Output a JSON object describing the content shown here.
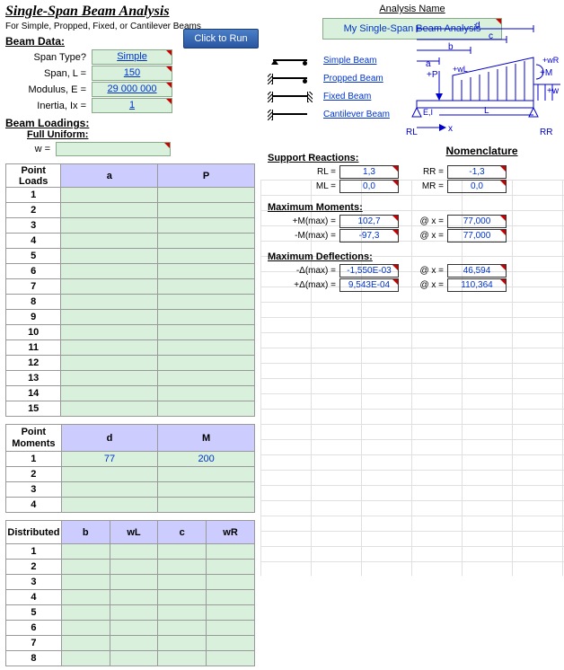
{
  "title": "Single-Span Beam Analysis",
  "subtitle": "For Simple, Propped, Fixed, or Cantilever Beams",
  "run_btn": "Click to Run",
  "beam_data": {
    "heading": "Beam Data:",
    "span_type_lbl": "Span Type?",
    "span_type": "Simple",
    "span_lbl": "Span, L =",
    "span": "150",
    "modulus_lbl": "Modulus, E =",
    "modulus": "29 000 000",
    "inertia_lbl": "Inertia, Ix =",
    "inertia": "1"
  },
  "beam_loadings": {
    "heading": "Beam Loadings:",
    "full_uniform_lbl": "Full Uniform:",
    "w_lbl": "w =",
    "w": ""
  },
  "point_loads": {
    "heading": "Point Loads",
    "cols": [
      "a",
      "P"
    ],
    "rows": [
      {
        "n": "1",
        "a": "",
        "p": ""
      },
      {
        "n": "2",
        "a": "",
        "p": ""
      },
      {
        "n": "3",
        "a": "",
        "p": ""
      },
      {
        "n": "4",
        "a": "",
        "p": ""
      },
      {
        "n": "5",
        "a": "",
        "p": ""
      },
      {
        "n": "6",
        "a": "",
        "p": ""
      },
      {
        "n": "7",
        "a": "",
        "p": ""
      },
      {
        "n": "8",
        "a": "",
        "p": ""
      },
      {
        "n": "9",
        "a": "",
        "p": ""
      },
      {
        "n": "10",
        "a": "",
        "p": ""
      },
      {
        "n": "11",
        "a": "",
        "p": ""
      },
      {
        "n": "12",
        "a": "",
        "p": ""
      },
      {
        "n": "13",
        "a": "",
        "p": ""
      },
      {
        "n": "14",
        "a": "",
        "p": ""
      },
      {
        "n": "15",
        "a": "",
        "p": ""
      }
    ]
  },
  "point_moments": {
    "heading": "Point Moments",
    "cols": [
      "d",
      "M"
    ],
    "rows": [
      {
        "n": "1",
        "d": "77",
        "m": "200"
      },
      {
        "n": "2",
        "d": "",
        "m": ""
      },
      {
        "n": "3",
        "d": "",
        "m": ""
      },
      {
        "n": "4",
        "d": "",
        "m": ""
      }
    ]
  },
  "distributed": {
    "heading": "Distributed",
    "cols": [
      "b",
      "wL",
      "c",
      "wR"
    ],
    "rows": [
      {
        "n": "1"
      },
      {
        "n": "2"
      },
      {
        "n": "3"
      },
      {
        "n": "4"
      },
      {
        "n": "5"
      },
      {
        "n": "6"
      },
      {
        "n": "7"
      },
      {
        "n": "8"
      }
    ]
  },
  "analysis_name_lbl": "Analysis Name",
  "analysis_name": "My Single-Span Beam Analysis",
  "beam_types": {
    "simple": "Simple Beam",
    "propped": "Propped Beam",
    "fixed": "Fixed Beam",
    "cantilever": "Cantilever Beam"
  },
  "nomenclature_title": "Nomenclature",
  "support_reactions": {
    "title": "Support Reactions:",
    "rl_lbl": "RL =",
    "rl": "1,3",
    "ml_lbl": "ML =",
    "ml": "0,0",
    "rr_lbl": "RR =",
    "rr": "-1,3",
    "mr_lbl": "MR =",
    "mr": "0,0"
  },
  "max_moments": {
    "title": "Maximum Moments:",
    "pos_lbl": "+M(max) =",
    "pos": "102,7",
    "pos_x_lbl": "@ x =",
    "pos_x": "77,000",
    "neg_lbl": "-M(max) =",
    "neg": "-97,3",
    "neg_x_lbl": "@ x =",
    "neg_x": "77,000"
  },
  "max_deflections": {
    "title": "Maximum Deflections:",
    "neg_lbl": "-Δ(max) =",
    "neg": "-1,550E-03",
    "neg_x_lbl": "@ x =",
    "neg_x": "46,594",
    "pos_lbl": "+Δ(max) =",
    "pos": "9,543E-04",
    "pos_x_lbl": "@ x =",
    "pos_x": "110,364"
  },
  "diagram_labels": {
    "d": "d",
    "c": "c",
    "b": "b",
    "a": "a",
    "P": "+P",
    "wL": "+wL",
    "wR": "+wR",
    "M": "+M",
    "w": "+w",
    "EI": "E,I",
    "L": "L",
    "RL": "RL",
    "RR": "RR",
    "x": "x"
  }
}
